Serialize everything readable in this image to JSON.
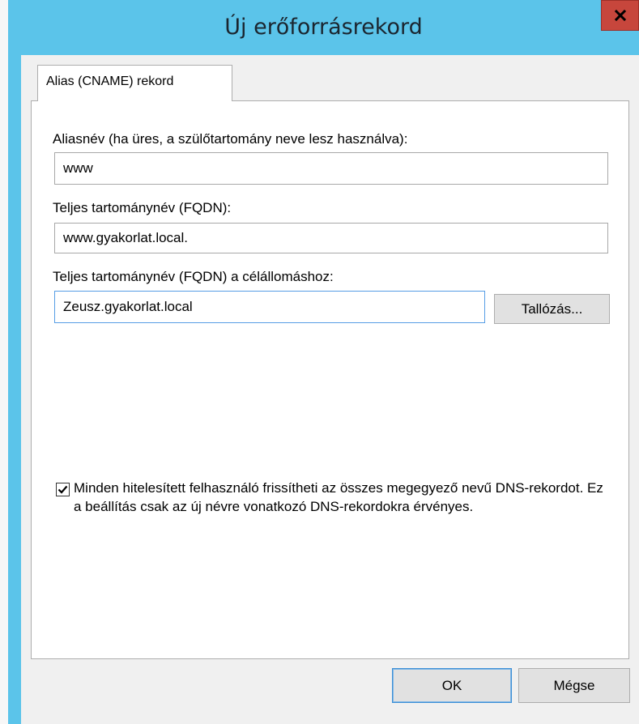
{
  "window": {
    "title": "Új erőforrásrekord",
    "close_label": "x"
  },
  "tab": {
    "label": "Alias (CNAME) rekord"
  },
  "alias": {
    "label": "Aliasnév (ha üres, a szülőtartomány neve lesz használva):",
    "value": "www"
  },
  "fqdn": {
    "label": "Teljes tartománynév (FQDN):",
    "value": "www.gyakorlat.local."
  },
  "target": {
    "label": "Teljes tartománynév (FQDN) a célállomáshoz:",
    "value": "Zeusz.gyakorlat.local",
    "browse_label": "Tallózás..."
  },
  "update_option": {
    "checked": true,
    "text": "Minden hitelesített felhasználó frissítheti az összes megegyező nevű DNS-rekordot. Ez a beállítás csak az új névre vonatkozó DNS-rekordokra érvényes."
  },
  "buttons": {
    "ok_label": "OK",
    "cancel_label": "Mégse"
  },
  "colors": {
    "titlebar": "#5bc4ea",
    "close_button": "#c7463c",
    "default_button_border": "#3c8fd6"
  }
}
